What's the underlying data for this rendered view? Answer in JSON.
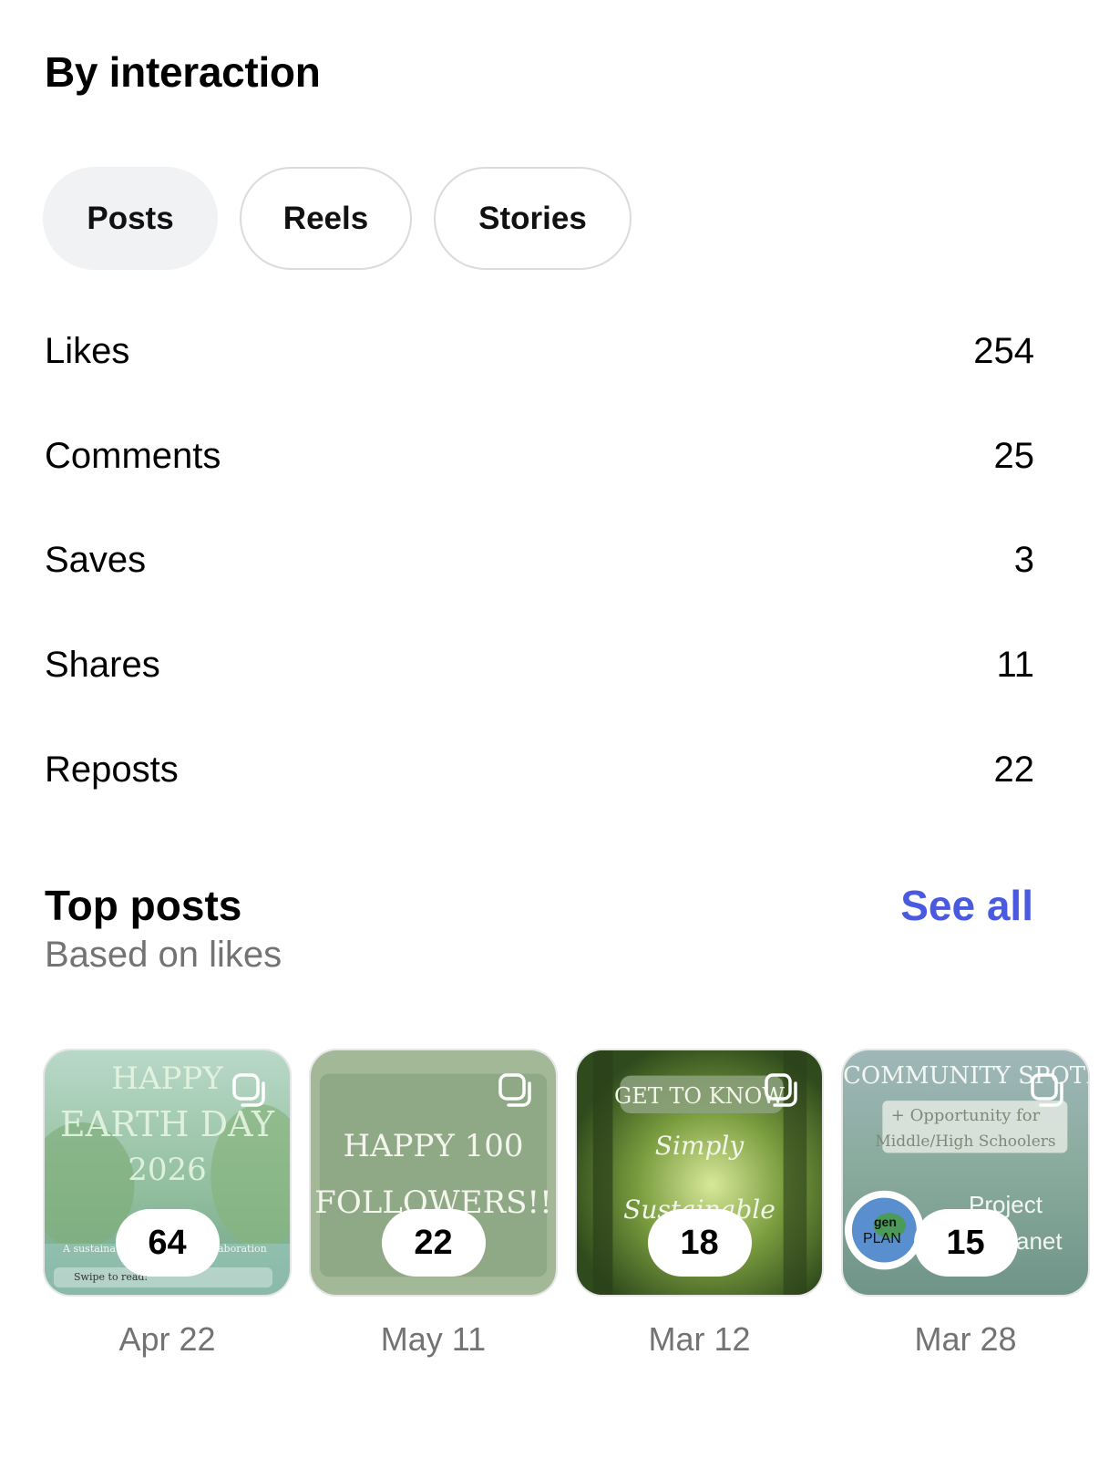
{
  "header": {
    "title": "By interaction"
  },
  "tabs": [
    {
      "label": "Posts",
      "active": true
    },
    {
      "label": "Reels",
      "active": false
    },
    {
      "label": "Stories",
      "active": false
    }
  ],
  "stats": [
    {
      "label": "Likes",
      "value": "254"
    },
    {
      "label": "Comments",
      "value": "25"
    },
    {
      "label": "Saves",
      "value": "3"
    },
    {
      "label": "Shares",
      "value": "11"
    },
    {
      "label": "Reposts",
      "value": "22"
    }
  ],
  "top_posts": {
    "title": "Top posts",
    "subtitle": "Based on likes",
    "see_all": "See all",
    "posts": [
      {
        "count": "64",
        "date": "Apr 22",
        "text_lines": [
          "HAPPY",
          "EARTH DAY",
          "2026"
        ],
        "caption": "A sustaina",
        "caption2": "aboration",
        "swipe": "Swipe to read:"
      },
      {
        "count": "22",
        "date": "May 11",
        "text_lines": [
          "HAPPY 100",
          "FOLLOWERS!!"
        ]
      },
      {
        "count": "18",
        "date": "Mar 12",
        "text_lines": [
          "GET TO KNOW",
          "Simply Sustainable"
        ]
      },
      {
        "count": "15",
        "date": "Mar 28",
        "text_lines": [
          "COMMUNITY SPOTLIGHT",
          "+ Opportunity for",
          "Middle/High Schoolers",
          "Project",
          "anet"
        ],
        "logo_lines": [
          "gen",
          "PLAN"
        ]
      }
    ]
  },
  "colors": {
    "accent_link": "#4a5ae0",
    "active_pill_bg": "#f1f2f4",
    "muted_text": "#737373"
  },
  "icons": {
    "carousel": "carousel-icon"
  }
}
